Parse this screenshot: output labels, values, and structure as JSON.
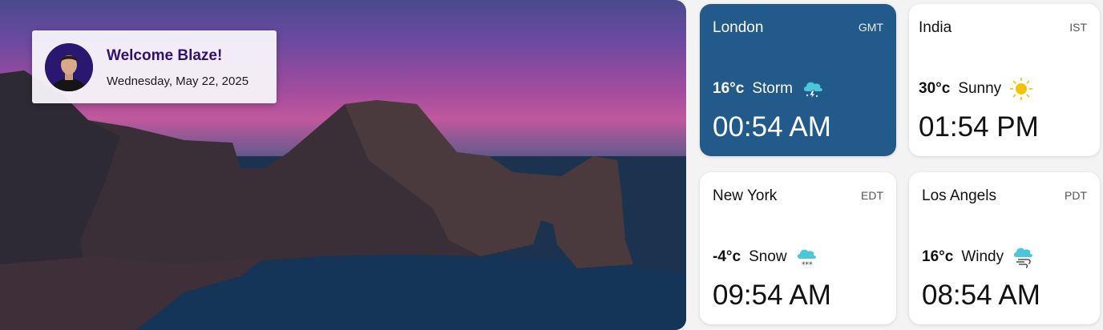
{
  "welcome": {
    "title": "Welcome Blaze!",
    "date": "Wednesday, May 22, 2025"
  },
  "cards": [
    {
      "city": "London",
      "tz": "GMT",
      "temp": "16°c",
      "condition": "Storm",
      "icon": "storm-icon",
      "time": "00:54 AM",
      "active": true
    },
    {
      "city": "India",
      "tz": "IST",
      "temp": "30°c",
      "condition": "Sunny",
      "icon": "sun-icon",
      "time": "01:54 PM",
      "active": false
    },
    {
      "city": "New York",
      "tz": "EDT",
      "temp": "-4°c",
      "condition": "Snow",
      "icon": "snow-icon",
      "time": "09:54 AM",
      "active": false
    },
    {
      "city": "Los Angels",
      "tz": "PDT",
      "temp": "16°c",
      "condition": "Windy",
      "icon": "wind-icon",
      "time": "08:54 AM",
      "active": false
    }
  ],
  "colors": {
    "active_card": "#225a8c",
    "welcome_title": "#32106e",
    "icon_cyan": "#4cc6d9",
    "sun": "#f2c400"
  }
}
